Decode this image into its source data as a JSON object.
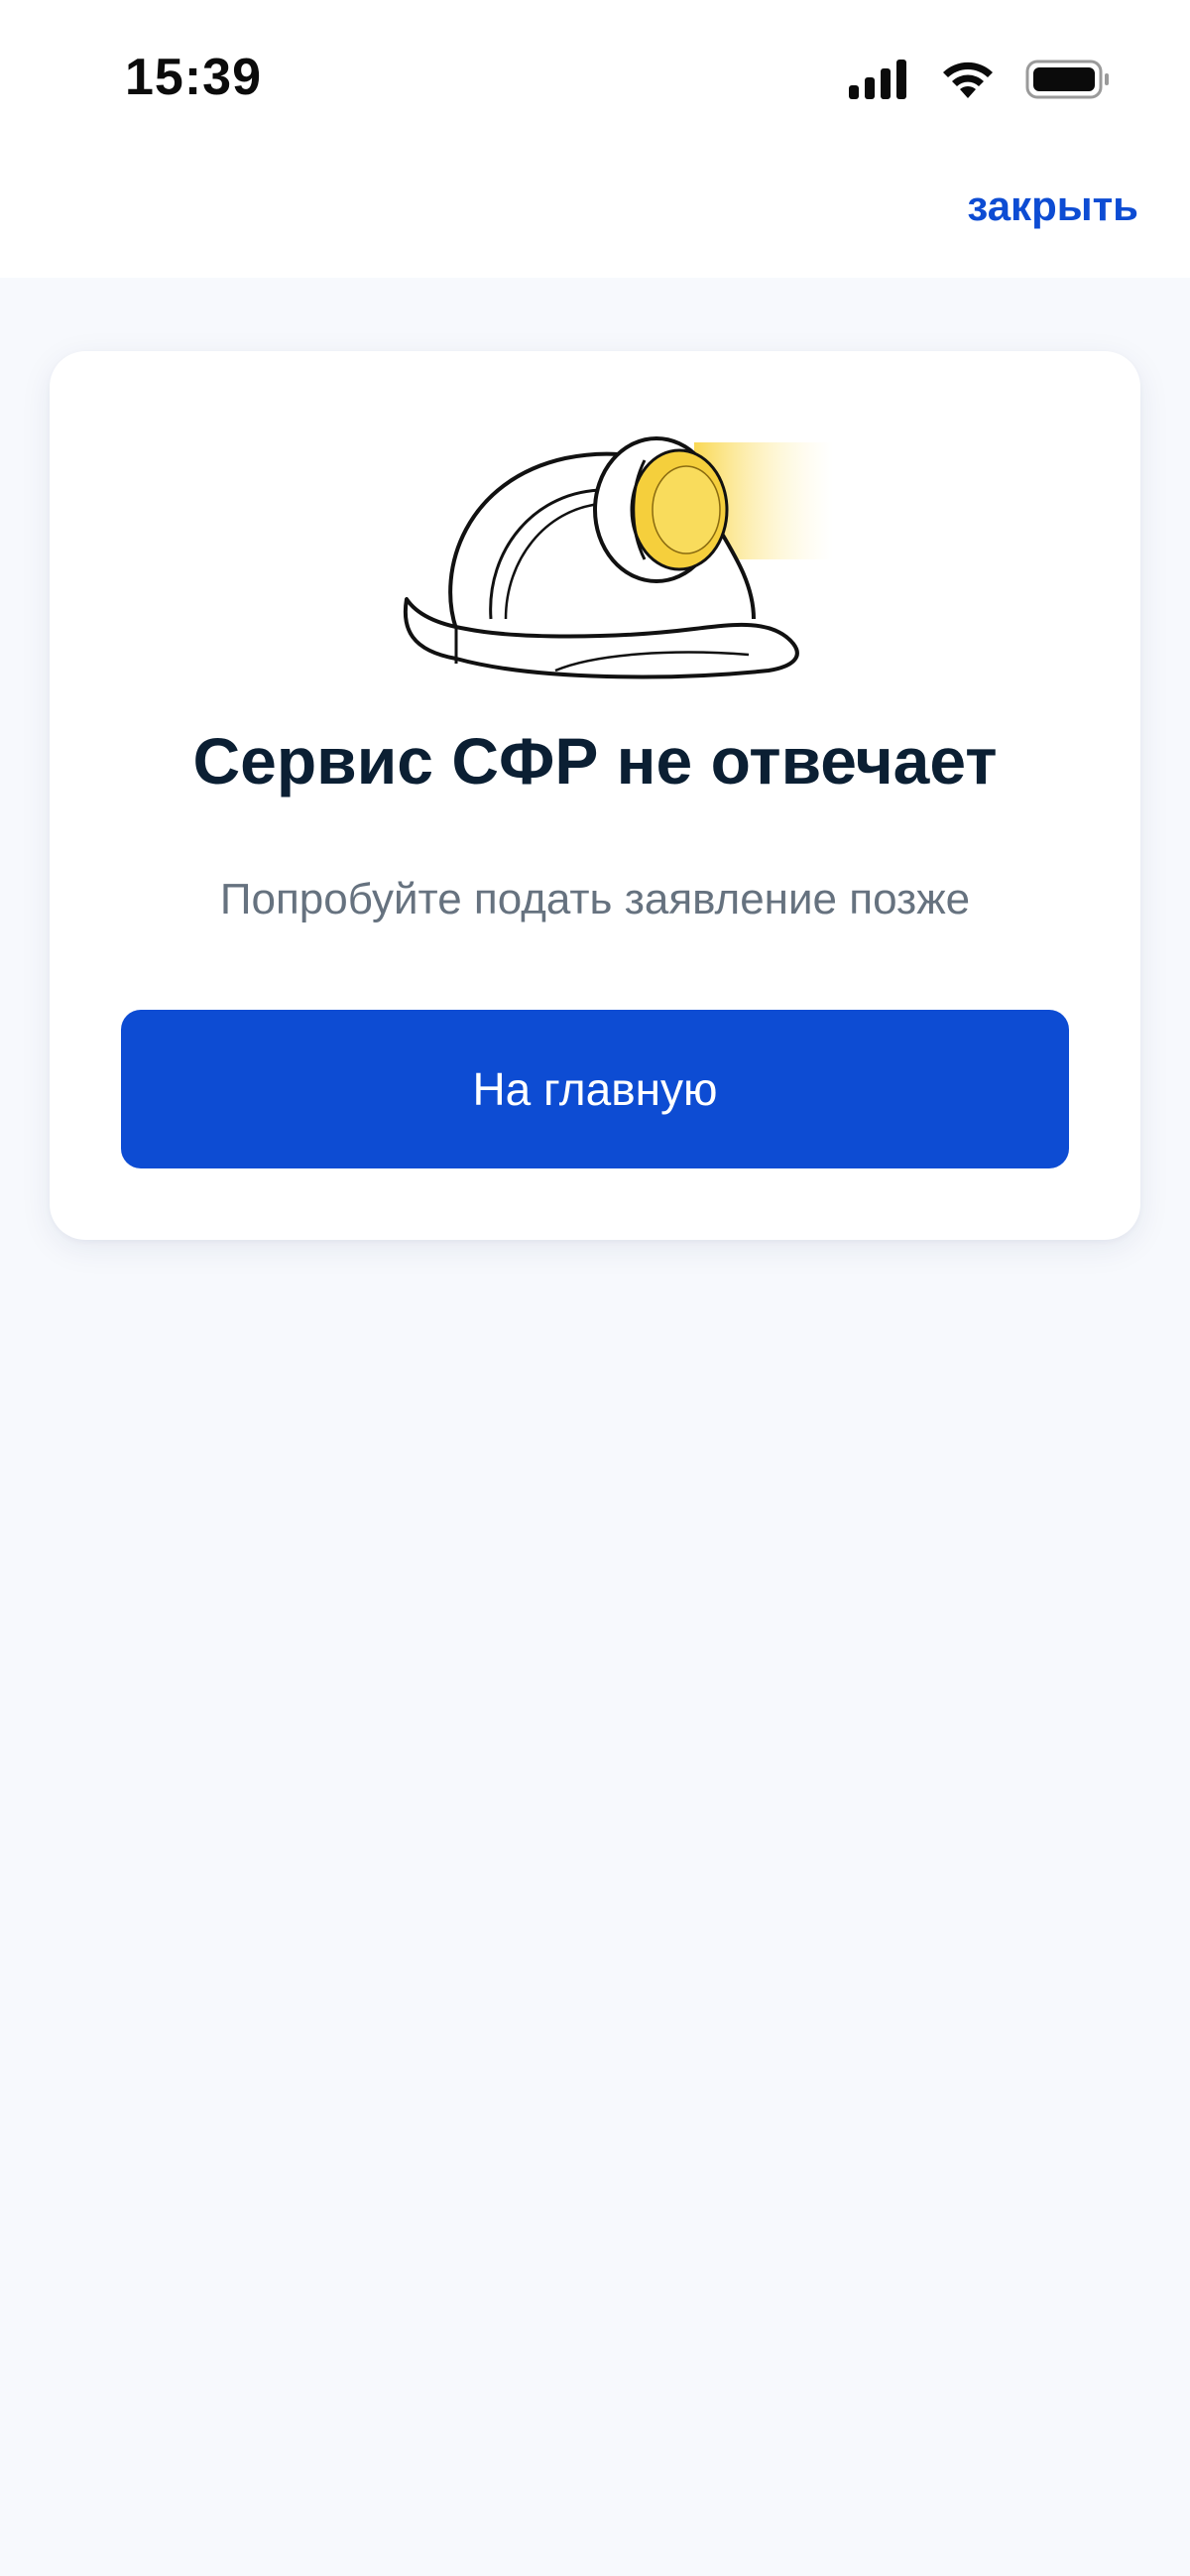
{
  "status_bar": {
    "time": "15:39"
  },
  "header": {
    "close_label": "закрыть"
  },
  "card": {
    "title": "Сервис СФР не отвечает",
    "subtitle": "Попробуйте подать заявление позже",
    "button_label": "На главную",
    "illustration_icon": "miner-helmet-with-lamp"
  },
  "colors": {
    "accent": "#0d4cd3",
    "title": "#0b1f33",
    "subtitle": "#66727f",
    "background": "#f7f9fd",
    "lamp": "#f5cf3c"
  }
}
